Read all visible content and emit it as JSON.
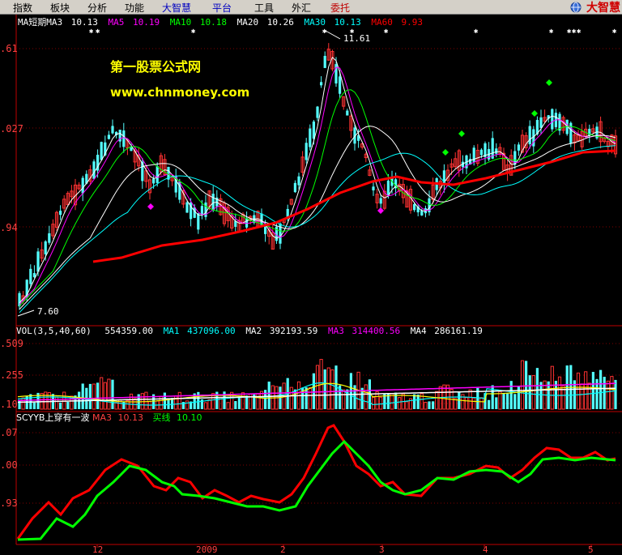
{
  "menu": {
    "items": [
      {
        "label": "指数",
        "color": "black"
      },
      {
        "label": "板块",
        "color": "black"
      },
      {
        "label": "分析",
        "color": "black"
      },
      {
        "label": "功能",
        "color": "black"
      },
      {
        "label": "大智慧",
        "color": "blue"
      },
      {
        "label": "平台",
        "color": "blue"
      },
      {
        "label": "工具",
        "color": "black"
      },
      {
        "label": "外汇",
        "color": "black"
      },
      {
        "label": "委托",
        "color": "red"
      }
    ],
    "logo": "大智慧"
  },
  "main_panel": {
    "legend": [
      {
        "label": "MA短期MA3",
        "value": "10.13",
        "color": "#ffffff"
      },
      {
        "label": "MA5",
        "value": "10.19",
        "color": "#ff00ff"
      },
      {
        "label": "MA10",
        "value": "10.18",
        "color": "#00ff00"
      },
      {
        "label": "MA20",
        "value": "10.26",
        "color": "#ffffff"
      },
      {
        "label": "MA30",
        "value": "10.13",
        "color": "#00ffff"
      },
      {
        "label": "MA60",
        "value": "9.93",
        "color": "#ff0000"
      }
    ],
    "y_labels": [
      ".61",
      ".027",
      ".94"
    ],
    "watermark_title": "第一股票公式网",
    "watermark_url": "www.chnmoney.com",
    "high_label": "11.61",
    "low_label": "7.60"
  },
  "volume_panel": {
    "header": "VOL(3,5,40,60)",
    "vol_value": "554359.00",
    "ma_labels": [
      {
        "label": "MA1",
        "value": "437096.00",
        "color": "#00ffff"
      },
      {
        "label": "MA2",
        "value": "392193.59",
        "color": "#ffffff"
      },
      {
        "label": "MA3",
        "value": "314400.56",
        "color": "#ff00ff"
      },
      {
        "label": "MA4",
        "value": "286161.19",
        "color": "#ffffff"
      }
    ],
    "y_labels": [
      ".509",
      ".255",
      ".10"
    ]
  },
  "indicator_panel": {
    "header": "SCYYB上穿有一波",
    "ma3_label": "MA3",
    "ma3_value": "10.13",
    "buy_label": "买线",
    "buy_value": "10.10",
    "y_labels": [
      ".07",
      ".00",
      ".93"
    ]
  },
  "x_axis": {
    "labels": [
      "12",
      "2009",
      "2",
      "3",
      "4",
      "5"
    ]
  },
  "colors": {
    "candle_up": "#ff3232",
    "candle_down": "#54ffff",
    "ma60": "#ff0000",
    "indicator_red": "#ff0000",
    "indicator_green": "#00ff00",
    "axis": "#c00000",
    "watermark": "#ffff00"
  }
}
